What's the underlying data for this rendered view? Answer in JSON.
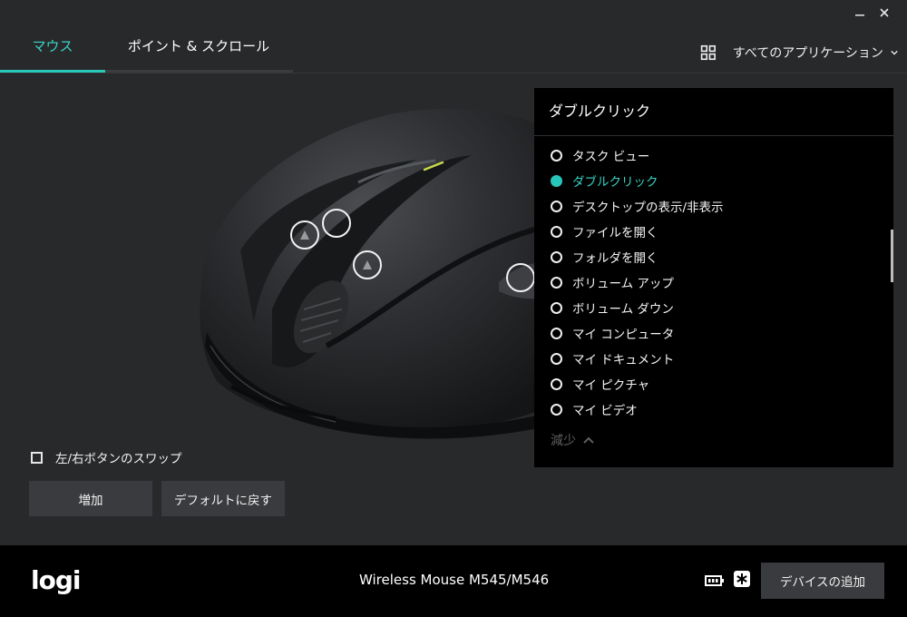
{
  "window": {
    "minimize_icon": "minimize-icon",
    "close_icon": "close-icon"
  },
  "tabs": [
    {
      "label": "マウス",
      "active": true
    },
    {
      "label": "ポイント & スクロール",
      "active": false
    }
  ],
  "app_selector": {
    "label": "すべてのアプリケーション",
    "icon": "grid-icon"
  },
  "panel": {
    "title": "ダブルクリック",
    "options": [
      {
        "label": "タスク ビュー",
        "selected": false
      },
      {
        "label": "ダブルクリック",
        "selected": true
      },
      {
        "label": "デスクトップの表示/非表示",
        "selected": false
      },
      {
        "label": "ファイルを開く",
        "selected": false
      },
      {
        "label": "フォルダを開く",
        "selected": false
      },
      {
        "label": "ボリューム アップ",
        "selected": false
      },
      {
        "label": "ボリューム ダウン",
        "selected": false
      },
      {
        "label": "マイ コンピュータ",
        "selected": false
      },
      {
        "label": "マイ ドキュメント",
        "selected": false
      },
      {
        "label": "マイ ピクチャ",
        "selected": false
      },
      {
        "label": "マイ ビデオ",
        "selected": false
      }
    ],
    "collapse_label": "減少"
  },
  "swap": {
    "label": "左/右ボタンのスワップ",
    "checked": false
  },
  "buttons": {
    "add": "増加",
    "default": "デフォルトに戻す"
  },
  "footer": {
    "logo": "logi",
    "device_name": "Wireless Mouse M545/M546",
    "add_device": "デバイスの追加"
  },
  "colors": {
    "accent": "#29c8b9",
    "panel_bg": "#000000",
    "app_bg": "#28292b",
    "button_bg": "#3a3b3e"
  }
}
